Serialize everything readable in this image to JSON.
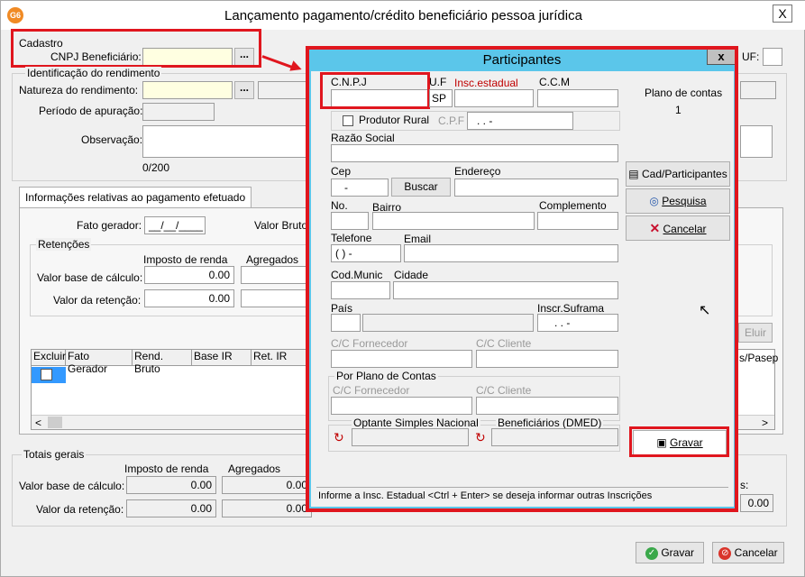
{
  "window": {
    "title": "Lançamento pagamento/crédito beneficiário pessoa jurídica",
    "close": "X",
    "app_icon": "G6"
  },
  "cadastro": {
    "caption": "Cadastro",
    "cnpj_label": "CNPJ Beneficiário:",
    "lookup": "...",
    "uf_label": "UF:"
  },
  "identificacao": {
    "caption": "Identificação do rendimento",
    "natureza_label": "Natureza do rendimento:",
    "lookup": "...",
    "periodo_label": "Período de apuração:",
    "observacao_label": "Observação:",
    "counter": "0/200"
  },
  "tab": {
    "label": "Informações relativas ao pagamento efetuado"
  },
  "pagamento": {
    "fato_label": "Fato gerador:",
    "fato_value": "__/__/____",
    "valor_bruto_label": "Valor Bruto"
  },
  "retencoes": {
    "caption": "Retenções",
    "col_imposto": "Imposto de renda",
    "col_agregados": "Agregados",
    "base_label": "Valor base de cálculo:",
    "base_value": "0.00",
    "ret_label": "Valor da retenção:",
    "ret_value": "0.00",
    "excluir_label": "Eluir"
  },
  "grid": {
    "headers": [
      "Excluir",
      "Fato Gerador",
      "Rend. Bruto",
      "Base IR",
      "Ret. IR"
    ],
    "last_header": "s/Pasep"
  },
  "totais": {
    "caption": "Totais gerais",
    "col_imposto": "Imposto de renda",
    "col_agregados": "Agregados",
    "base_label": "Valor base de cálculo:",
    "ret_label": "Valor da retenção:",
    "values": [
      "0.00",
      "0.00",
      "0.00",
      "0.00"
    ],
    "right_label": "s:",
    "right_value": "0.00"
  },
  "footer": {
    "gravar": "Gravar",
    "cancelar": "Cancelar"
  },
  "modal": {
    "title": "Participantes",
    "close": "x",
    "cnpj": "C.N.P.J",
    "uf": "U.F",
    "uf_value": "SP",
    "insc": "Insc.estadual",
    "ccm": "C.C.M",
    "plano_label": "Plano de contas",
    "plano_value": "1",
    "produtor": "Produtor Rural",
    "cpf": "C.P.F",
    "cpf_mask": ". .  -",
    "razao": "Razão Social",
    "cep": "Cep",
    "cep_mask": "-",
    "buscar": "Buscar",
    "endereco": "Endereço",
    "no": "No.",
    "bairro": "Bairro",
    "complemento": "Complemento",
    "telefone": "Telefone",
    "tel_mask": "( )  -",
    "email": "Email",
    "codmunic": "Cod.Munic",
    "cidade": "Cidade",
    "pais": "País",
    "suframa": "Inscr.Suframa",
    "suframa_mask": ". .  -",
    "cc_fornecedor": "C/C Fornecedor",
    "cc_cliente": "C/C Cliente",
    "por_plano": "Por Plano de Contas",
    "optante": "Optante Simples Nacional",
    "beneficiarios": "Beneficiários (DMED)",
    "cad_btn": "Cad/Participantes",
    "pesquisa_btn": "Pesquisa",
    "cancelar_btn": "Cancelar",
    "gravar_btn": "Gravar",
    "status": "Informe a Insc. Estadual  <Ctrl + Enter> se deseja informar outras Inscrições"
  },
  "colors": {
    "highlight": "#e0161e",
    "modal_frame": "#5bc6ea",
    "input_yellow": "#ffffe1"
  }
}
